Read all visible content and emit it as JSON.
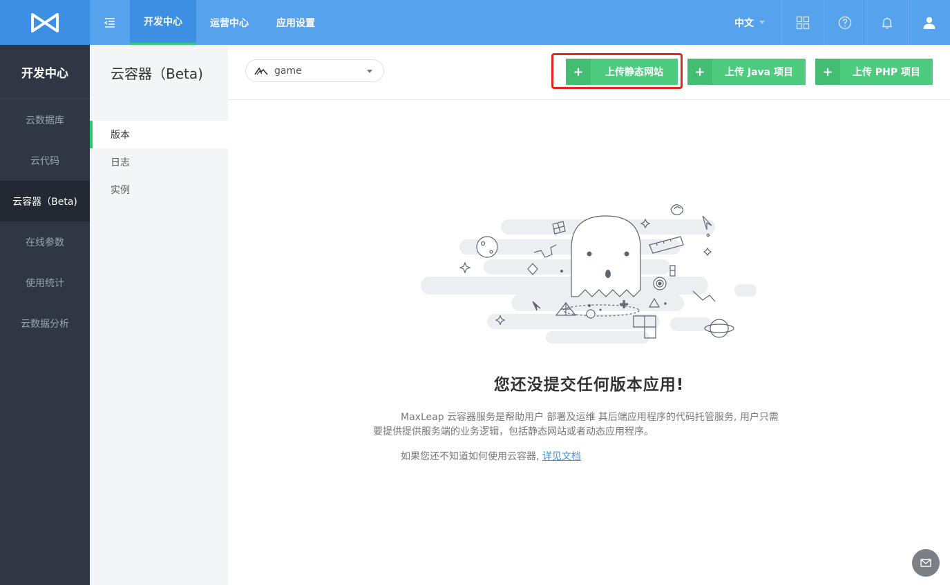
{
  "topbar": {
    "tabs": [
      {
        "label": "开发中心"
      },
      {
        "label": "运营中心"
      },
      {
        "label": "应用设置"
      }
    ],
    "language": "中文"
  },
  "sidebar": {
    "title": "开发中心",
    "items": [
      {
        "label": "云数据库"
      },
      {
        "label": "云代码"
      },
      {
        "label": "云容器（Beta)"
      },
      {
        "label": "在线参数"
      },
      {
        "label": "使用统计"
      },
      {
        "label": "云数据分析"
      }
    ]
  },
  "subnav": {
    "title": "云容器（Beta)",
    "items": [
      {
        "label": "版本"
      },
      {
        "label": "日志"
      },
      {
        "label": "实例"
      }
    ]
  },
  "header": {
    "app_name": "game",
    "buttons": [
      {
        "plus": "+",
        "label": "上传静态网站"
      },
      {
        "plus": "+",
        "label": "上传 Java 项目"
      },
      {
        "plus": "+",
        "label": "上传 PHP 项目"
      }
    ]
  },
  "empty_state": {
    "title": "您还没提交任何版本应用!",
    "description": "MaxLeap 云容器服务是帮助用户 部署及运维 其后端应用程序的代码托管服务, 用户只需要提供提供服务端的业务逻辑，包括静态网站或者动态应用程序。",
    "help_text": "如果您还不知道如何使用云容器, ",
    "help_link": "详见文档"
  },
  "colors": {
    "topbar": "#56a2ec",
    "active_tab": "#3d8fe3",
    "sidebar": "#2f3744",
    "button_green": "#4dcb7f",
    "highlight": "#e2261c"
  }
}
